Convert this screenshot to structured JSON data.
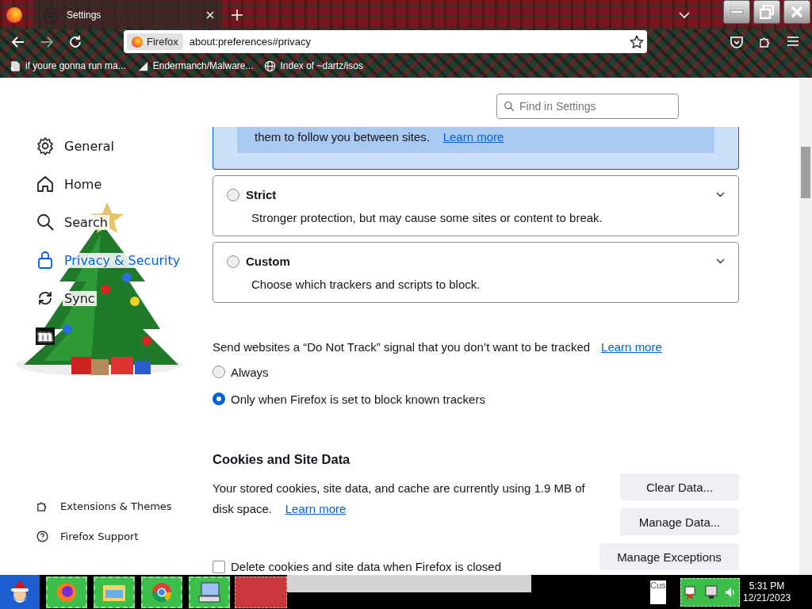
{
  "tabs": [
    {
      "label": "Settings",
      "selected": true
    }
  ],
  "toolbar": {
    "url_chip": "Firefox",
    "url": "about:preferences#privacy",
    "forward_disabled": true
  },
  "bookmarks": [
    {
      "label": "if youre gonna run ma...",
      "kind": "page"
    },
    {
      "label": "Endermanch/Malware...",
      "kind": "github"
    },
    {
      "label": "Index of ~dartz/isos",
      "kind": "globe"
    }
  ],
  "search": {
    "placeholder": "Find in Settings"
  },
  "sidebar": {
    "items": [
      {
        "label": "General",
        "kind": "gear",
        "selected": false
      },
      {
        "label": "Home",
        "kind": "home",
        "selected": false
      },
      {
        "label": "Search",
        "kind": "search",
        "selected": false
      },
      {
        "label": "Privacy & Security",
        "kind": "lock",
        "selected": true
      },
      {
        "label": "Sync",
        "kind": "sync",
        "selected": false
      },
      {
        "label": "m",
        "kind": "logo",
        "selected": false
      }
    ],
    "footer": [
      {
        "label": "Extensions & Themes",
        "kind": "puzzle"
      },
      {
        "label": "Firefox Support",
        "kind": "help"
      }
    ]
  },
  "protection_levels": [
    {
      "kind": "standard",
      "selected": true,
      "description": "them to follow you between sites.",
      "link": "Learn more"
    },
    {
      "kind": "strict",
      "selected": false,
      "title": "Strict",
      "description": "Stronger protection, but may cause some sites or content to break."
    },
    {
      "kind": "custom",
      "selected": false,
      "title": "Custom",
      "description": "Choose which trackers and scripts to block."
    }
  ],
  "do_not_track": {
    "text": "Send websites a “Do Not Track” signal that you don’t want to be tracked",
    "link": "Learn more",
    "options": [
      {
        "label": "Always",
        "selected": false
      },
      {
        "label": "Only when Firefox is set to block known trackers",
        "selected": true
      }
    ]
  },
  "cookies": {
    "heading": "Cookies and Site Data",
    "text": "Your stored cookies, site data, and cache are currently using 1.9 MB of disk space.",
    "link": "Learn more",
    "buttons": [
      "Clear Data...",
      "Manage Data...",
      "Manage Exceptions"
    ],
    "delete_on_close": {
      "label": "Delete cookies and site data when Firefox is closed",
      "checked": false
    }
  },
  "taskbar": {
    "tray_label": "Cus",
    "time": "5:31 PM",
    "date": "12/21/2023"
  }
}
